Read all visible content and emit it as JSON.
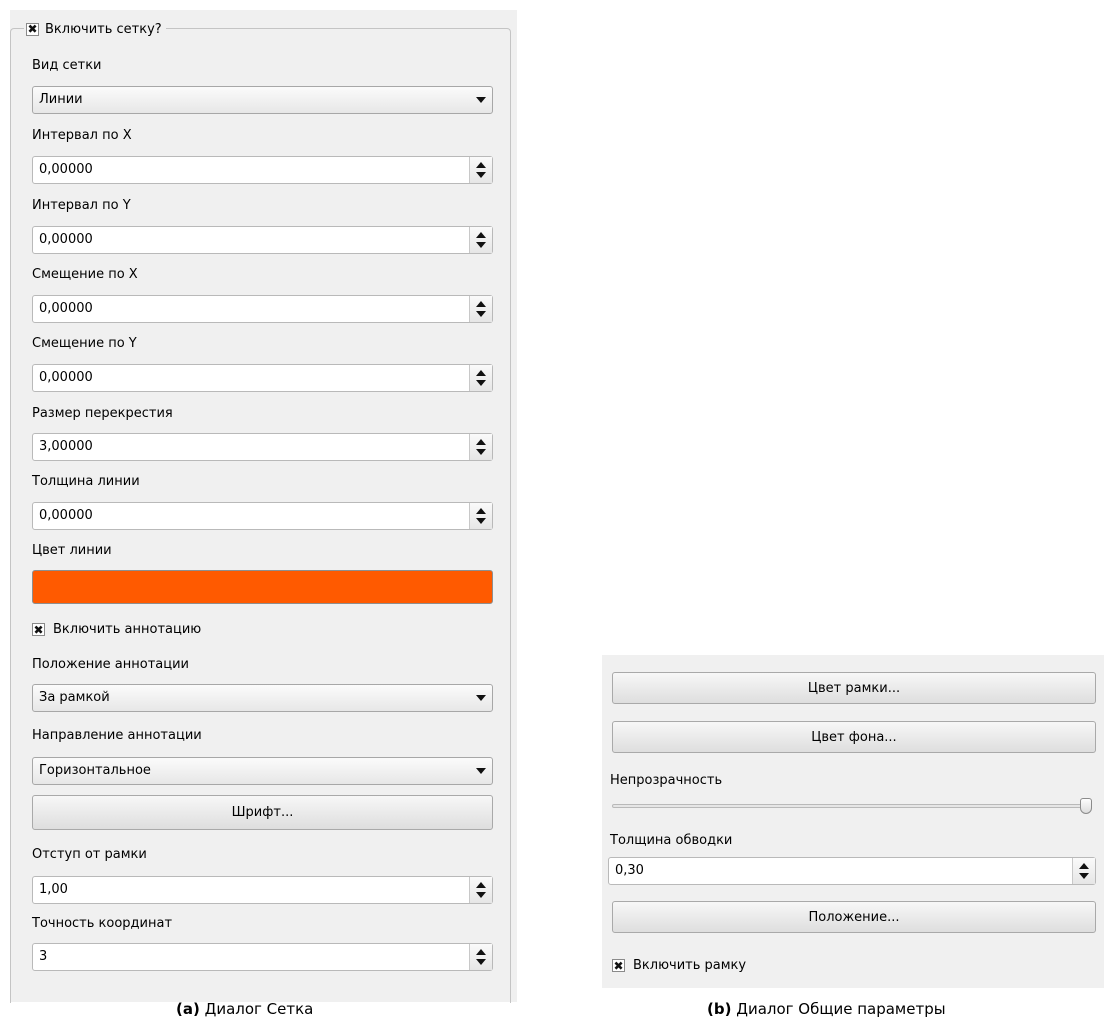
{
  "grid_dialog": {
    "enable_grid_label": "Включить сетку?",
    "grid_type_label": "Вид сетки",
    "grid_type_value": "Линии",
    "interval_x_label": "Интервал по X",
    "interval_x_value": "0,00000",
    "interval_y_label": "Интервал по Y",
    "interval_y_value": "0,00000",
    "offset_x_label": "Смещение по X",
    "offset_x_value": "0,00000",
    "offset_y_label": "Смещение по Y",
    "offset_y_value": "0,00000",
    "cross_size_label": "Размер перекрестия",
    "cross_size_value": "3,00000",
    "line_width_label": "Толщина линии",
    "line_width_value": "0,00000",
    "line_color_label": "Цвет линии",
    "line_color": "#ff5a00",
    "enable_annotation_label": "Включить аннотацию",
    "annotation_position_label": "Положение аннотации",
    "annotation_position_value": "За рамкой",
    "annotation_direction_label": "Направление аннотации",
    "annotation_direction_value": "Горизонтальное",
    "font_button": "Шрифт...",
    "frame_offset_label": "Отступ от рамки",
    "frame_offset_value": "1,00",
    "coord_precision_label": "Точность координат",
    "coord_precision_value": "3"
  },
  "general_dialog": {
    "frame_color_button": "Цвет рамки...",
    "background_color_button": "Цвет фона...",
    "opacity_label": "Непрозрачность",
    "opacity_value": 1.0,
    "outline_width_label": "Толщина обводки",
    "outline_width_value": "0,30",
    "position_button": "Положение...",
    "enable_frame_label": "Включить рамку"
  },
  "captions": {
    "a_prefix": "(a)",
    "a_text": " Диалог Сетка",
    "b_prefix": "(b)",
    "b_text": " Диалог Общие параметры"
  },
  "checkbox_mark": "✖"
}
